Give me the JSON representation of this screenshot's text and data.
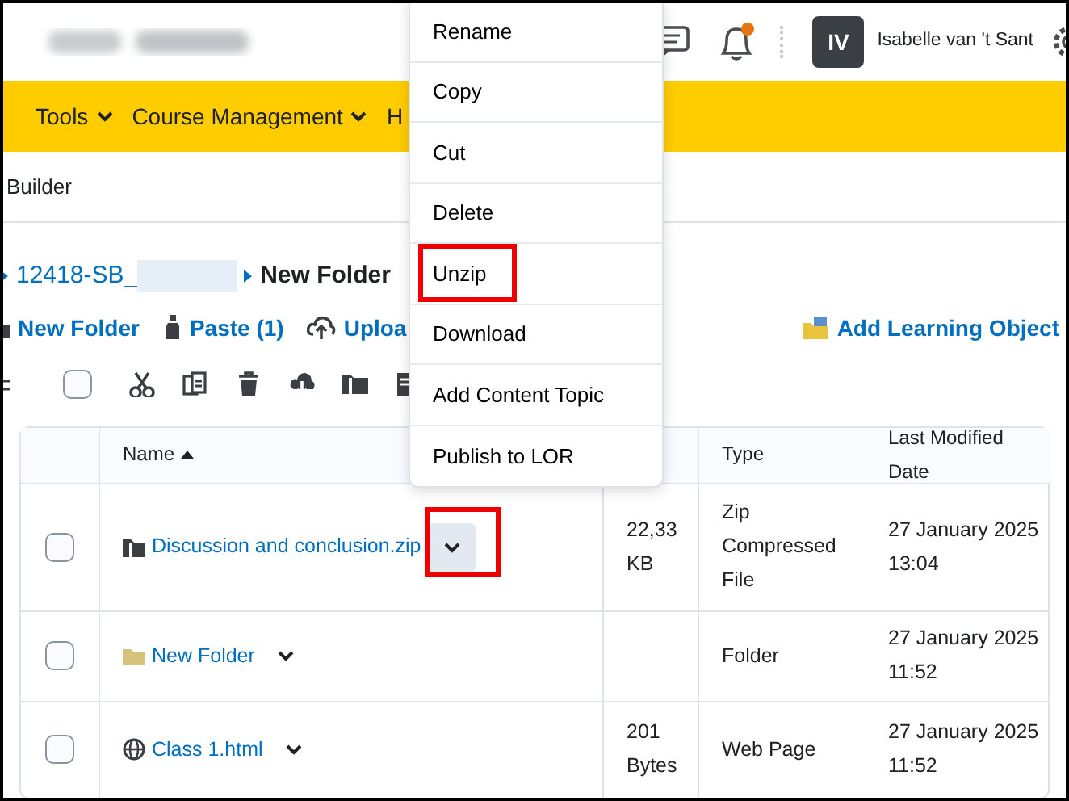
{
  "header": {
    "notifications_unread": true,
    "user": {
      "initials": "IV",
      "name": "Isabelle van 't Sant"
    }
  },
  "nav": [
    {
      "label": "Tools",
      "dropdown": true
    },
    {
      "label": "Course Management",
      "dropdown": true
    },
    {
      "label": "H",
      "dropdown": false
    }
  ],
  "subnav": "Builder",
  "breadcrumb": [
    {
      "label": "12418-SB_",
      "current": false,
      "redacted": true
    },
    {
      "label": "New Folder",
      "current": true,
      "redacted": false
    }
  ],
  "actions": [
    {
      "label": "New Folder",
      "kind": "folder"
    },
    {
      "label": "Paste (1)",
      "kind": "paste"
    },
    {
      "label": "Uploa",
      "kind": "upload"
    },
    {
      "label": "Add Learning Object",
      "kind": "learning-object"
    }
  ],
  "toolbar": {
    "select_all_checked": false
  },
  "table": {
    "columns": [
      {
        "label": "Name",
        "sorted": true
      },
      {
        "label": "Type",
        "sorted": false
      },
      {
        "label": "Last Modified Date",
        "sorted": false
      }
    ],
    "rows": [
      {
        "checked": false,
        "kind": "zip",
        "name": "Discussion and conclusion.zip",
        "size": "22,33 KB",
        "type": "Zip Compressed File",
        "date": "27 January 2025 13:04",
        "menu_open": true,
        "annotated": true
      },
      {
        "checked": false,
        "kind": "folder",
        "name": "New Folder",
        "type": "Folder",
        "date": "27 January 2025 11:52",
        "menu_open": false,
        "annotated": false
      },
      {
        "checked": false,
        "kind": "webpage",
        "name": "Class 1.html",
        "size": "201 Bytes",
        "type": "Web Page",
        "date": "27 January 2025 11:52",
        "menu_open": false,
        "annotated": false
      }
    ]
  },
  "context_menu": {
    "items": [
      {
        "label": "Rename",
        "annotated": false
      },
      {
        "label": "Copy",
        "annotated": false
      },
      {
        "label": "Cut",
        "annotated": false
      },
      {
        "label": "Delete",
        "annotated": false
      },
      {
        "label": "Unzip",
        "annotated": true
      },
      {
        "label": "Download",
        "annotated": false
      },
      {
        "label": "Add Content Topic",
        "annotated": false
      },
      {
        "label": "Publish to LOR",
        "annotated": false
      }
    ]
  }
}
